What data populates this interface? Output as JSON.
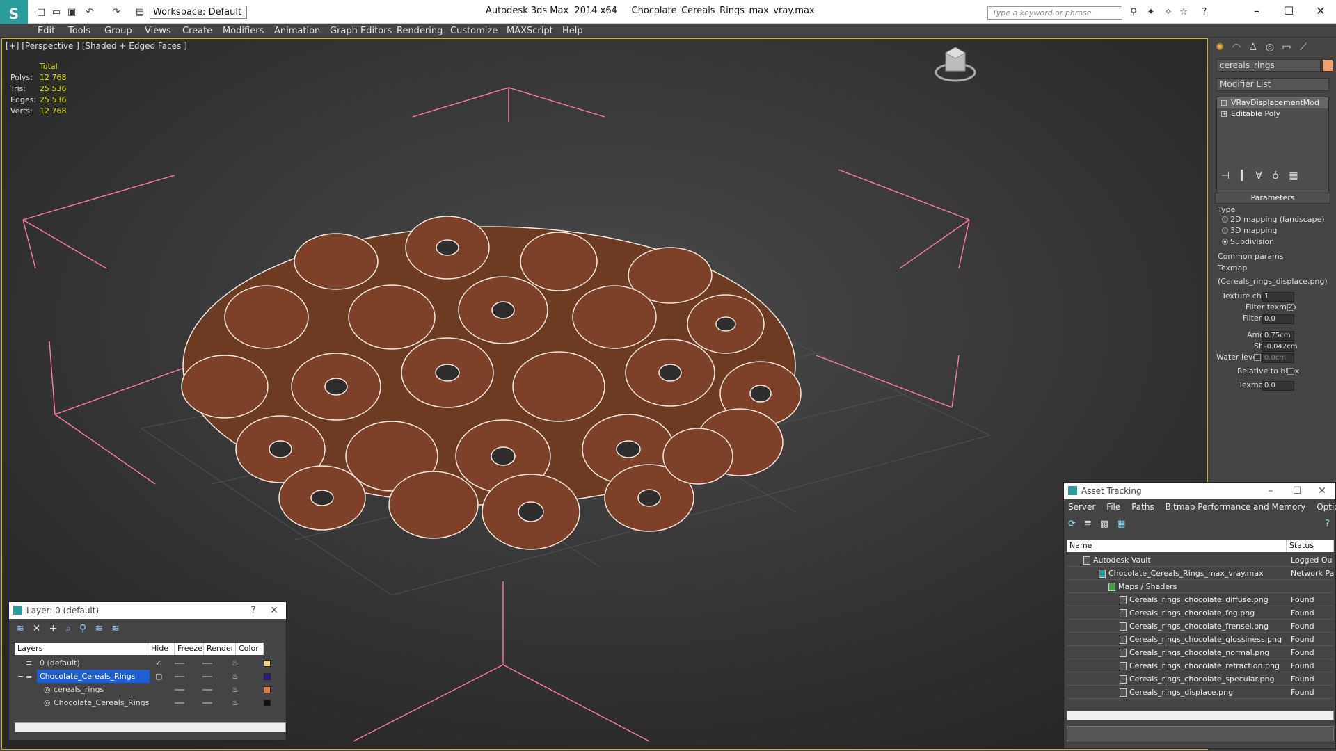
{
  "app": {
    "logo_letter": "S",
    "title": "Autodesk 3ds Max  2014 x64     Chocolate_Cereals_Rings_max_vray.max",
    "workspace": "Workspace: Default",
    "search_placeholder": "Type a keyword or phrase"
  },
  "menu": [
    "Edit",
    "Tools",
    "Group",
    "Views",
    "Create",
    "Modifiers",
    "Animation",
    "Graph Editors",
    "Rendering",
    "Customize",
    "MAXScript",
    "Help"
  ],
  "viewport": {
    "label": "[+] [Perspective ] [Shaded + Edged Faces ]",
    "stats_header": "Total",
    "stats": [
      {
        "k": "Polys:",
        "v": "12 768"
      },
      {
        "k": "Tris:",
        "v": "25 536"
      },
      {
        "k": "Edges:",
        "v": "25 536"
      },
      {
        "k": "Verts:",
        "v": "12 768"
      }
    ]
  },
  "command_panel": {
    "object_name": "cereals_rings",
    "modifier_list": "Modifier List",
    "stack": [
      "VRayDisplacementMod",
      "Editable Poly"
    ],
    "parameters": "Parameters",
    "type_label": "Type",
    "types": [
      "2D mapping (landscape)",
      "3D mapping",
      "Subdivision"
    ],
    "selected_type": 2,
    "common_params": "Common params",
    "texmap_label": "Texmap",
    "texmap_value": "(Cereals_rings_displace.png)",
    "texture_chan_label": "Texture chan",
    "texture_chan": "1",
    "filter_texmap_label": "Filter texmap",
    "filter_blur_label": "Filter blur",
    "filter_blur": "0.0",
    "amount_label": "Amount",
    "amount": "0.75cm",
    "shift_label": "Shift",
    "shift": "-0.042cm",
    "water_level_label": "Water level",
    "water_level": "0.0cm",
    "relative_label": "Relative to bbox",
    "texmap_min_label": "Texmap min",
    "texmap_min": "0.0"
  },
  "layers": {
    "title": "Layer: 0 (default)",
    "help": "?",
    "columns": [
      "Layers",
      "Hide",
      "Freeze",
      "Render",
      "Color"
    ],
    "rows": [
      {
        "name": "0 (default)",
        "color": "#f2d47c"
      },
      {
        "name": "Chocolate_Cereals_Rings",
        "color": "#2c1a8a"
      },
      {
        "name": "cereals_rings",
        "color": "#e37a3a"
      },
      {
        "name": "Chocolate_Cereals_Rings",
        "color": "#111111"
      }
    ]
  },
  "asset_tracking": {
    "title": "Asset Tracking",
    "menu": [
      "Server",
      "File",
      "Paths",
      "Bitmap Performance and Memory",
      "Options"
    ],
    "col_name": "Name",
    "col_status": "Status",
    "rows": [
      {
        "name": "Autodesk Vault",
        "status": "Logged Ou",
        "indent": 0
      },
      {
        "name": "Chocolate_Cereals_Rings_max_vray.max",
        "status": "Network Pa",
        "indent": 1
      },
      {
        "name": "Maps / Shaders",
        "status": "",
        "indent": 2
      },
      {
        "name": "Cereals_rings_chocolate_diffuse.png",
        "status": "Found",
        "indent": 3
      },
      {
        "name": "Cereals_rings_chocolate_fog.png",
        "status": "Found",
        "indent": 3
      },
      {
        "name": "Cereals_rings_chocolate_frensel.png",
        "status": "Found",
        "indent": 3
      },
      {
        "name": "Cereals_rings_chocolate_glossiness.png",
        "status": "Found",
        "indent": 3
      },
      {
        "name": "Cereals_rings_chocolate_normal.png",
        "status": "Found",
        "indent": 3
      },
      {
        "name": "Cereals_rings_chocolate_refraction.png",
        "status": "Found",
        "indent": 3
      },
      {
        "name": "Cereals_rings_chocolate_specular.png",
        "status": "Found",
        "indent": 3
      },
      {
        "name": "Cereals_rings_displace.png",
        "status": "Found",
        "indent": 3
      }
    ]
  }
}
